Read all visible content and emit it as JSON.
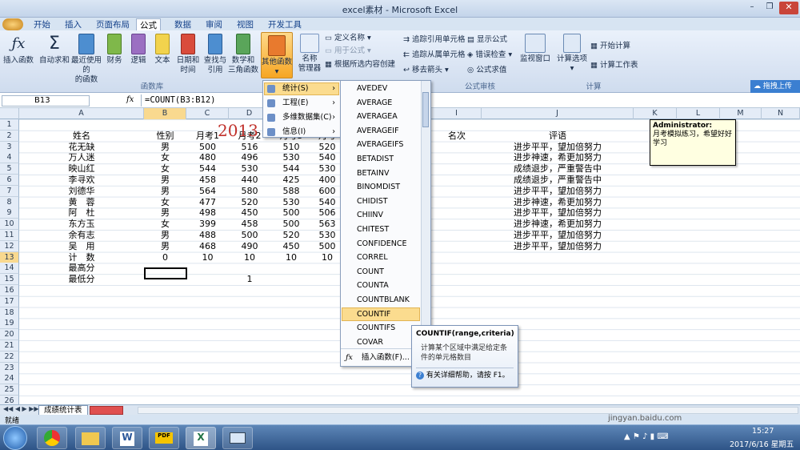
{
  "window": {
    "title": "excel素材 - Microsoft Excel"
  },
  "tabs": [
    "开始",
    "插入",
    "页面布局",
    "公式",
    "数据",
    "审阅",
    "视图",
    "开发工具"
  ],
  "ribbon": {
    "buttons": [
      {
        "label1": "插入函数",
        "label2": "",
        "icon": "fx-icon"
      },
      {
        "label1": "自动求和",
        "label2": "",
        "icon": "sum-icon"
      },
      {
        "label1": "最近使用的",
        "label2": "的函数",
        "icon": "book-icon"
      },
      {
        "label1": "财务",
        "label2": "",
        "icon": "book-icon"
      },
      {
        "label1": "逻辑",
        "label2": "",
        "icon": "book-icon"
      },
      {
        "label1": "文本",
        "label2": "",
        "icon": "book-icon"
      },
      {
        "label1": "日期和",
        "label2": "时间",
        "icon": "book-icon"
      },
      {
        "label1": "查找与",
        "label2": "引用",
        "icon": "book-icon"
      },
      {
        "label1": "数学和",
        "label2": "三角函数",
        "icon": "book-icon"
      },
      {
        "label1": "其他函数",
        "label2": "",
        "icon": "book-icon"
      }
    ],
    "name_manager": {
      "label1": "名称",
      "label2": "管理器"
    },
    "names_small": [
      "定义名称",
      "用于公式",
      "根据所选内容创建"
    ],
    "audit_small": [
      "追踪引用单元格",
      "追踪从属单元格",
      "移去箭头",
      "显示公式",
      "错误检查",
      "公式求值"
    ],
    "watch": "监视窗口",
    "calc_options": "计算选项",
    "calc_small": [
      "开始计算",
      "计算工作表"
    ],
    "groups": [
      "函数库",
      "公式审核",
      "计算"
    ],
    "right_panel": "拖拽上传"
  },
  "formula_bar": {
    "name_box": "B13",
    "fx": "fx",
    "formula": "=COUNT(B3:B12)"
  },
  "columns": [
    "A",
    "B",
    "C",
    "D",
    "E",
    "F",
    "G",
    "H",
    "I",
    "J",
    "K",
    "L",
    "M",
    "N"
  ],
  "rows": [
    "1",
    "2",
    "3",
    "4",
    "5",
    "6",
    "7",
    "8",
    "9",
    "10",
    "11",
    "12",
    "13",
    "14",
    "15",
    "16",
    "17",
    "18",
    "19",
    "20",
    "21",
    "22",
    "23",
    "24",
    "25",
    "26"
  ],
  "sheet": {
    "title": "2013",
    "headers": [
      "姓名",
      "性别",
      "月考1",
      "月考2",
      "月考3",
      "月考",
      "名次",
      "评语"
    ],
    "rows": [
      [
        "花无缺",
        "男",
        "500",
        "516",
        "510",
        "520",
        "进步平平，望加倍努力"
      ],
      [
        "万人迷",
        "女",
        "480",
        "496",
        "530",
        "540",
        "进步神速，希更加努力"
      ],
      [
        "映山红",
        "女",
        "544",
        "530",
        "544",
        "530",
        "成绩退步，严重警告中"
      ],
      [
        "李寻欢",
        "男",
        "458",
        "440",
        "425",
        "400",
        "成绩退步，严重警告中"
      ],
      [
        "刘德华",
        "男",
        "564",
        "580",
        "588",
        "600",
        "进步平平，望加倍努力"
      ],
      [
        "黄　蓉",
        "女",
        "477",
        "520",
        "530",
        "540",
        "进步神速，希更加努力"
      ],
      [
        "阿　杜",
        "男",
        "498",
        "450",
        "500",
        "506",
        "进步平平，望加倍努力"
      ],
      [
        "东方玉",
        "女",
        "399",
        "458",
        "500",
        "563",
        "进步神速，希更加努力"
      ],
      [
        "余有志",
        "男",
        "488",
        "500",
        "520",
        "530",
        "进步平平，望加倍努力"
      ],
      [
        "吴　用",
        "男",
        "468",
        "490",
        "450",
        "500",
        "进步平平，望加倍努力"
      ]
    ],
    "count_row": [
      "计　数",
      "0",
      "10",
      "10",
      "10",
      "10"
    ],
    "max_label": "最高分",
    "min_label": "最低分",
    "min_value": "1"
  },
  "comment": {
    "author": "Administrator:",
    "text": "月考模拟练习，希望好好学习"
  },
  "menu1": [
    "统计(S)",
    "工程(E)",
    "多维数据集(C)",
    "信息(I)"
  ],
  "menu2": [
    "AVEDEV",
    "AVERAGE",
    "AVERAGEA",
    "AVERAGEIF",
    "AVERAGEIFS",
    "BETADIST",
    "BETAINV",
    "BINOMDIST",
    "CHIDIST",
    "CHIINV",
    "CHITEST",
    "CONFIDENCE",
    "CORREL",
    "COUNT",
    "COUNTA",
    "COUNTBLANK",
    "COUNTIF",
    "COUNTIFS",
    "COVAR"
  ],
  "menu2_footer": "插入函数(F)...",
  "tooltip": {
    "title": "COUNTIF(range,criteria)",
    "desc": "计算某个区域中满足给定条件的单元格数目",
    "help": "有关详细帮助，请按 F1。"
  },
  "sheet_tabs": [
    "成绩统计表"
  ],
  "status": {
    "ready": "就绪",
    "watermark": "jingyan.baidu.com",
    "time": "15:27",
    "date": "2017/6/16 星期五"
  }
}
